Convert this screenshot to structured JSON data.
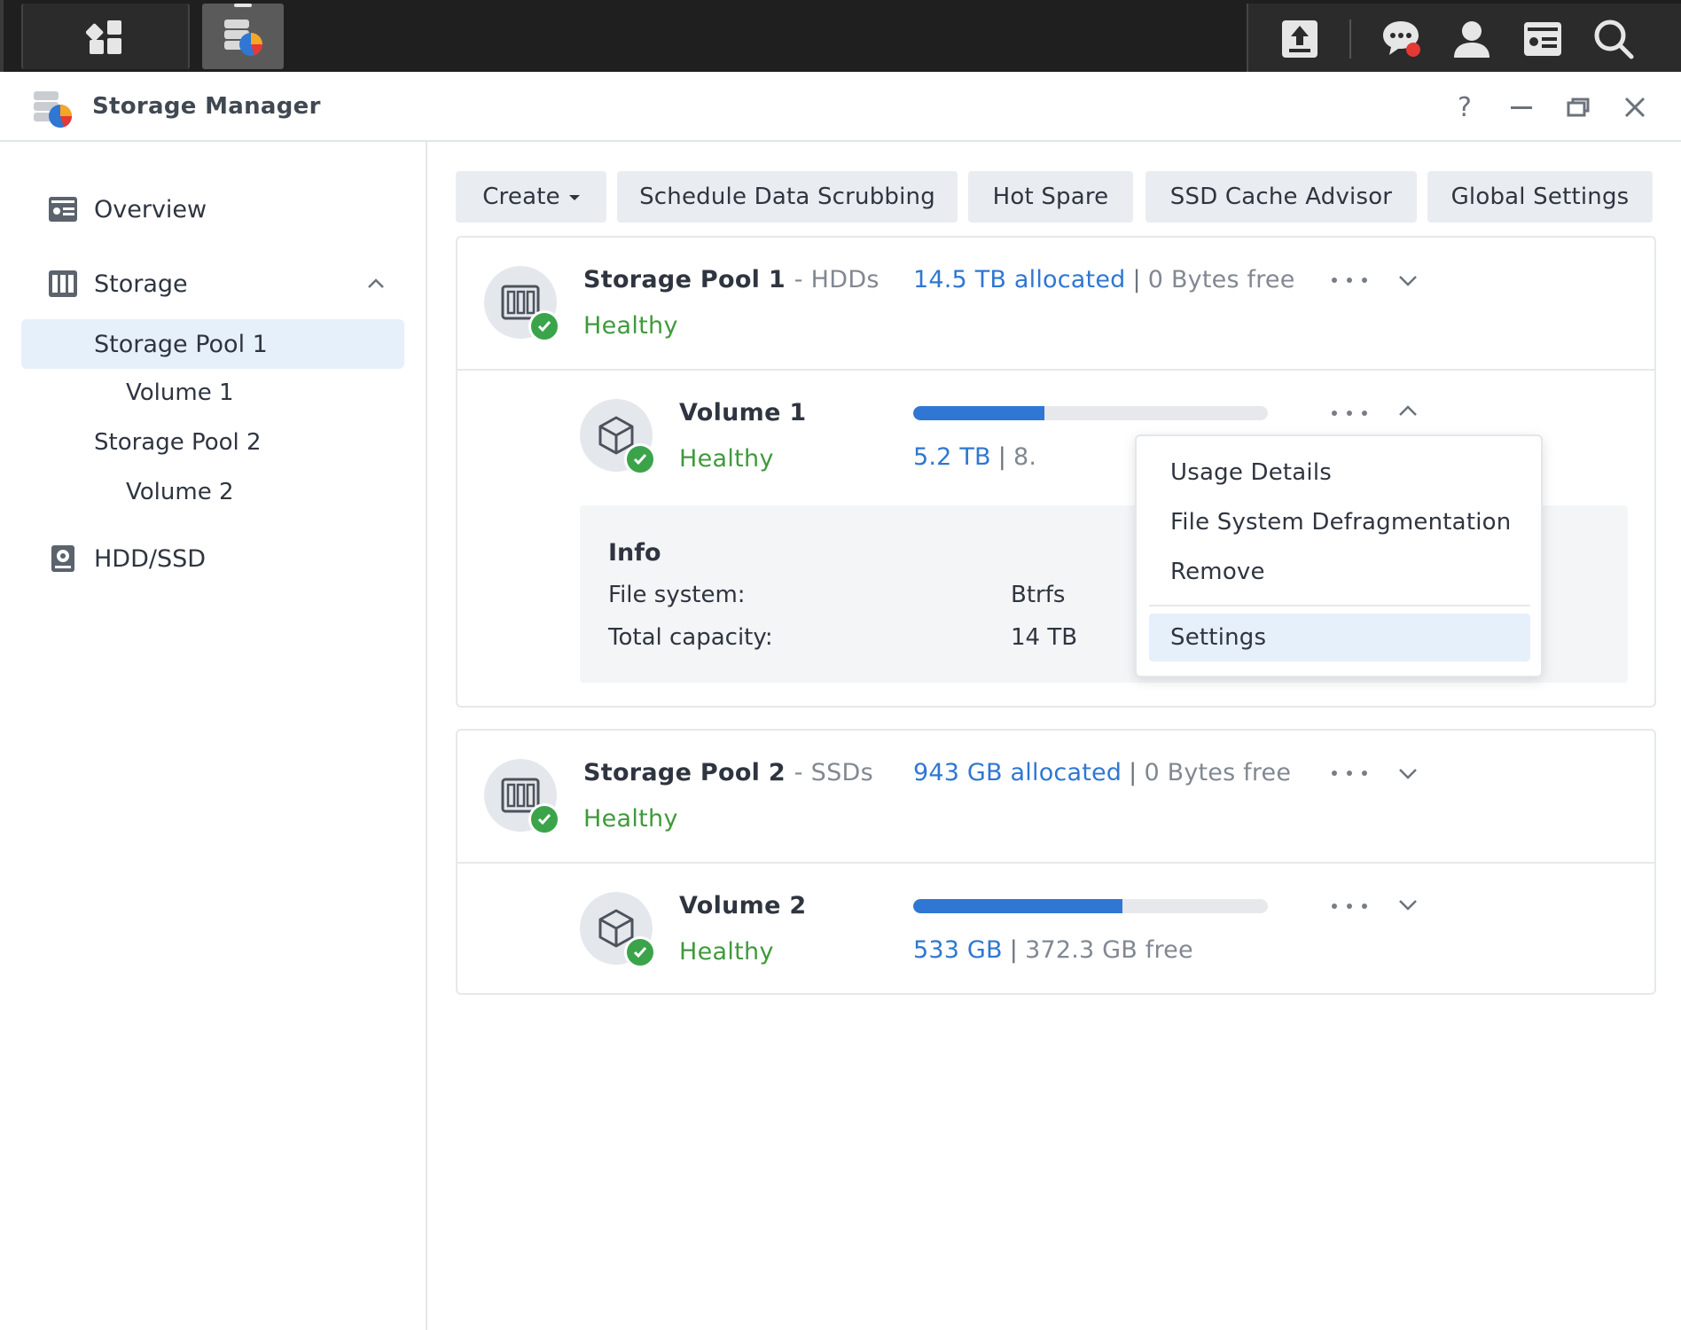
{
  "taskbar": {
    "left_buttons": [
      {
        "name": "show-desktop",
        "icon": "dashboard-icon"
      },
      {
        "name": "storage-manager",
        "icon": "storage-manager-icon",
        "active": true
      }
    ],
    "right_icons": [
      "upload-icon",
      "chat-icon",
      "user-icon",
      "widgets-icon",
      "search-icon"
    ],
    "chat_has_notification": true
  },
  "window": {
    "title": "Storage Manager",
    "controls": {
      "help": "?"
    }
  },
  "sidebar": {
    "overview": "Overview",
    "storage": "Storage",
    "storage_pool_1": "Storage Pool 1",
    "volume_1": "Volume 1",
    "storage_pool_2": "Storage Pool 2",
    "volume_2": "Volume 2",
    "hdd_ssd": "HDD/SSD"
  },
  "toolbar": {
    "create": "Create",
    "schedule": "Schedule Data Scrubbing",
    "hot_spare": "Hot Spare",
    "ssd_cache": "SSD Cache Advisor",
    "global_settings": "Global Settings"
  },
  "pool1": {
    "title": "Storage Pool 1",
    "subtitle": "- HDDs",
    "status": "Healthy",
    "allocated": "14.5 TB allocated",
    "separator": "|",
    "free": "0 Bytes free",
    "expanded": false
  },
  "volume1": {
    "title": "Volume 1",
    "status": "Healthy",
    "used": "5.2 TB",
    "separator": "|",
    "free_partial": "8.",
    "usage_fraction": 0.37,
    "expanded": true,
    "info": {
      "title": "Info",
      "fs_label": "File system:",
      "fs_value": "Btrfs",
      "cap_label": "Total capacity:",
      "cap_value": "14 TB"
    }
  },
  "context_menu": {
    "items": [
      "Usage Details",
      "File System Defragmentation",
      "Remove",
      "Settings"
    ],
    "highlighted": "Settings"
  },
  "pool2": {
    "title": "Storage Pool 2",
    "subtitle": "- SSDs",
    "status": "Healthy",
    "allocated": "943 GB allocated",
    "separator": "|",
    "free": "0 Bytes free",
    "expanded": false
  },
  "volume2": {
    "title": "Volume 2",
    "status": "Healthy",
    "used": "533 GB",
    "separator": "|",
    "free": "372.3 GB free",
    "usage_fraction": 0.59,
    "expanded": false
  },
  "colors": {
    "accent_blue": "#2f77d3",
    "healthy_green": "#3f9a3b",
    "notification_red": "#e53935"
  }
}
